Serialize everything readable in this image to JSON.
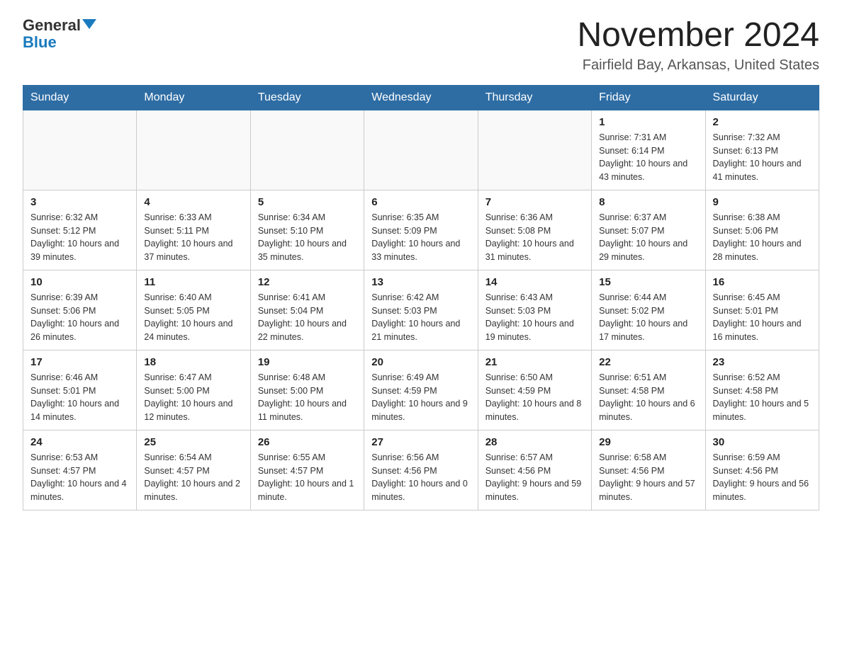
{
  "logo": {
    "text_general": "General",
    "text_blue": "Blue"
  },
  "header": {
    "month_year": "November 2024",
    "location": "Fairfield Bay, Arkansas, United States"
  },
  "weekdays": [
    "Sunday",
    "Monday",
    "Tuesday",
    "Wednesday",
    "Thursday",
    "Friday",
    "Saturday"
  ],
  "weeks": [
    [
      {
        "day": "",
        "info": ""
      },
      {
        "day": "",
        "info": ""
      },
      {
        "day": "",
        "info": ""
      },
      {
        "day": "",
        "info": ""
      },
      {
        "day": "",
        "info": ""
      },
      {
        "day": "1",
        "info": "Sunrise: 7:31 AM\nSunset: 6:14 PM\nDaylight: 10 hours and 43 minutes."
      },
      {
        "day": "2",
        "info": "Sunrise: 7:32 AM\nSunset: 6:13 PM\nDaylight: 10 hours and 41 minutes."
      }
    ],
    [
      {
        "day": "3",
        "info": "Sunrise: 6:32 AM\nSunset: 5:12 PM\nDaylight: 10 hours and 39 minutes."
      },
      {
        "day": "4",
        "info": "Sunrise: 6:33 AM\nSunset: 5:11 PM\nDaylight: 10 hours and 37 minutes."
      },
      {
        "day": "5",
        "info": "Sunrise: 6:34 AM\nSunset: 5:10 PM\nDaylight: 10 hours and 35 minutes."
      },
      {
        "day": "6",
        "info": "Sunrise: 6:35 AM\nSunset: 5:09 PM\nDaylight: 10 hours and 33 minutes."
      },
      {
        "day": "7",
        "info": "Sunrise: 6:36 AM\nSunset: 5:08 PM\nDaylight: 10 hours and 31 minutes."
      },
      {
        "day": "8",
        "info": "Sunrise: 6:37 AM\nSunset: 5:07 PM\nDaylight: 10 hours and 29 minutes."
      },
      {
        "day": "9",
        "info": "Sunrise: 6:38 AM\nSunset: 5:06 PM\nDaylight: 10 hours and 28 minutes."
      }
    ],
    [
      {
        "day": "10",
        "info": "Sunrise: 6:39 AM\nSunset: 5:06 PM\nDaylight: 10 hours and 26 minutes."
      },
      {
        "day": "11",
        "info": "Sunrise: 6:40 AM\nSunset: 5:05 PM\nDaylight: 10 hours and 24 minutes."
      },
      {
        "day": "12",
        "info": "Sunrise: 6:41 AM\nSunset: 5:04 PM\nDaylight: 10 hours and 22 minutes."
      },
      {
        "day": "13",
        "info": "Sunrise: 6:42 AM\nSunset: 5:03 PM\nDaylight: 10 hours and 21 minutes."
      },
      {
        "day": "14",
        "info": "Sunrise: 6:43 AM\nSunset: 5:03 PM\nDaylight: 10 hours and 19 minutes."
      },
      {
        "day": "15",
        "info": "Sunrise: 6:44 AM\nSunset: 5:02 PM\nDaylight: 10 hours and 17 minutes."
      },
      {
        "day": "16",
        "info": "Sunrise: 6:45 AM\nSunset: 5:01 PM\nDaylight: 10 hours and 16 minutes."
      }
    ],
    [
      {
        "day": "17",
        "info": "Sunrise: 6:46 AM\nSunset: 5:01 PM\nDaylight: 10 hours and 14 minutes."
      },
      {
        "day": "18",
        "info": "Sunrise: 6:47 AM\nSunset: 5:00 PM\nDaylight: 10 hours and 12 minutes."
      },
      {
        "day": "19",
        "info": "Sunrise: 6:48 AM\nSunset: 5:00 PM\nDaylight: 10 hours and 11 minutes."
      },
      {
        "day": "20",
        "info": "Sunrise: 6:49 AM\nSunset: 4:59 PM\nDaylight: 10 hours and 9 minutes."
      },
      {
        "day": "21",
        "info": "Sunrise: 6:50 AM\nSunset: 4:59 PM\nDaylight: 10 hours and 8 minutes."
      },
      {
        "day": "22",
        "info": "Sunrise: 6:51 AM\nSunset: 4:58 PM\nDaylight: 10 hours and 6 minutes."
      },
      {
        "day": "23",
        "info": "Sunrise: 6:52 AM\nSunset: 4:58 PM\nDaylight: 10 hours and 5 minutes."
      }
    ],
    [
      {
        "day": "24",
        "info": "Sunrise: 6:53 AM\nSunset: 4:57 PM\nDaylight: 10 hours and 4 minutes."
      },
      {
        "day": "25",
        "info": "Sunrise: 6:54 AM\nSunset: 4:57 PM\nDaylight: 10 hours and 2 minutes."
      },
      {
        "day": "26",
        "info": "Sunrise: 6:55 AM\nSunset: 4:57 PM\nDaylight: 10 hours and 1 minute."
      },
      {
        "day": "27",
        "info": "Sunrise: 6:56 AM\nSunset: 4:56 PM\nDaylight: 10 hours and 0 minutes."
      },
      {
        "day": "28",
        "info": "Sunrise: 6:57 AM\nSunset: 4:56 PM\nDaylight: 9 hours and 59 minutes."
      },
      {
        "day": "29",
        "info": "Sunrise: 6:58 AM\nSunset: 4:56 PM\nDaylight: 9 hours and 57 minutes."
      },
      {
        "day": "30",
        "info": "Sunrise: 6:59 AM\nSunset: 4:56 PM\nDaylight: 9 hours and 56 minutes."
      }
    ]
  ]
}
